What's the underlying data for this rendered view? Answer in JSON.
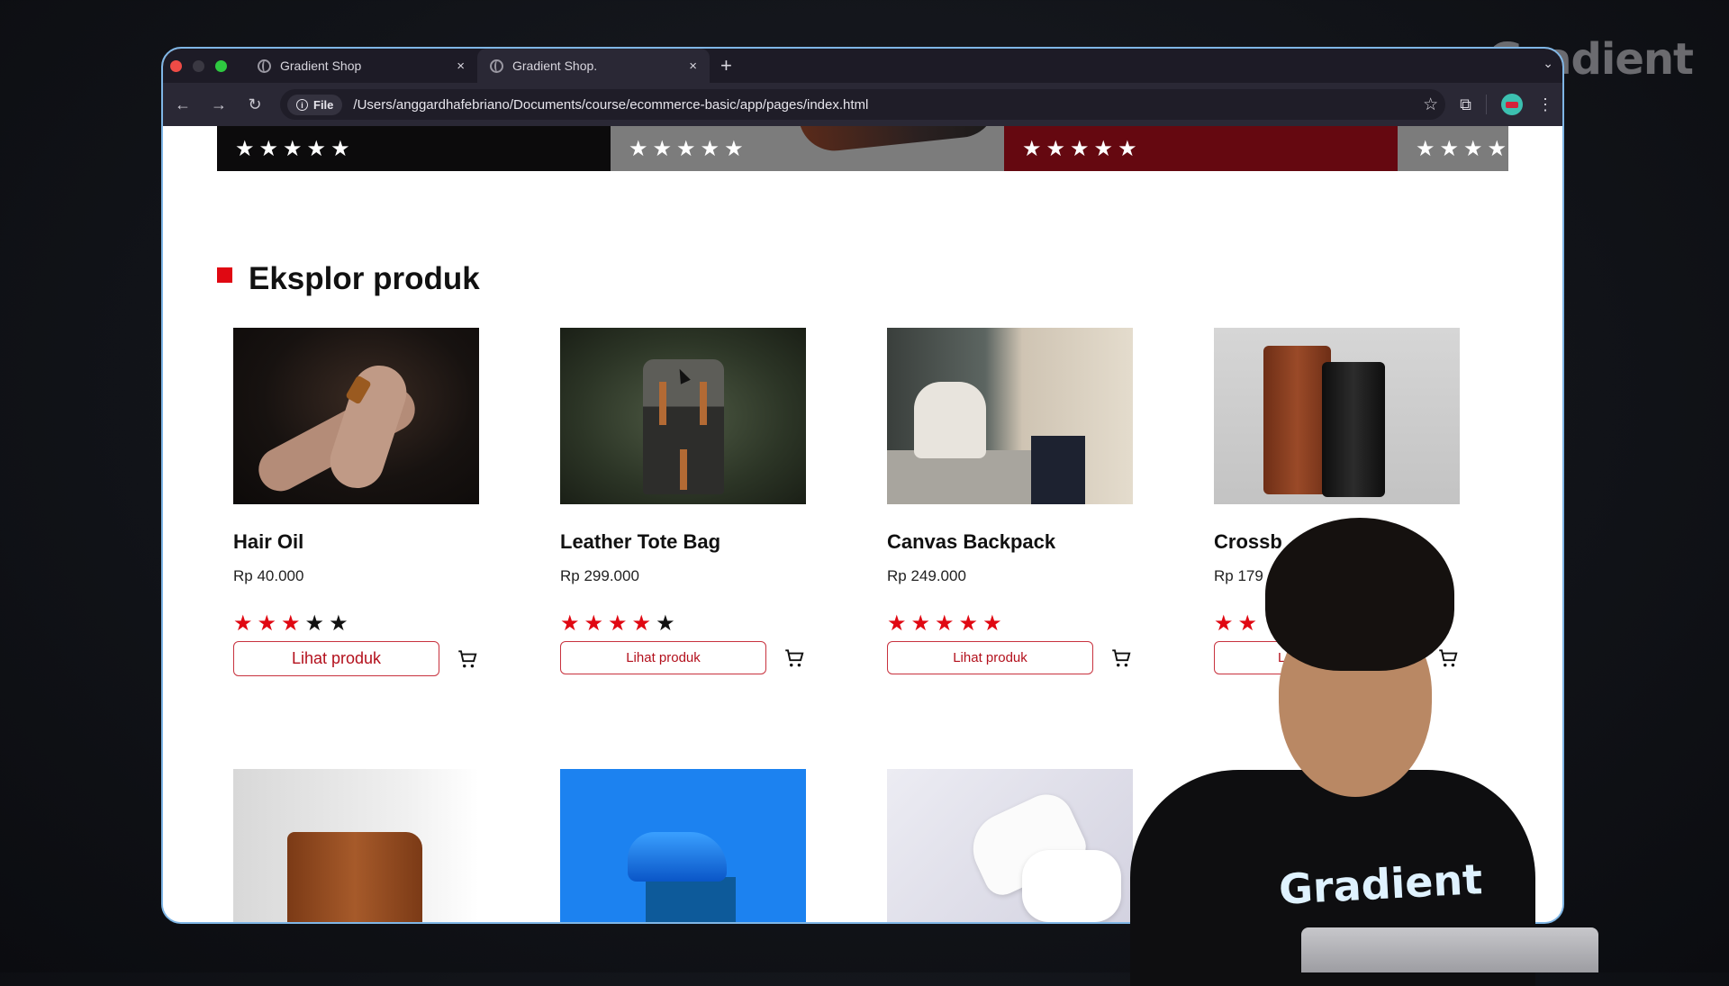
{
  "watermark": "Gradient",
  "browser": {
    "tabs": [
      {
        "title": "Gradient Shop",
        "active": false
      },
      {
        "title": "Gradient Shop.",
        "active": true
      }
    ],
    "new_tab_label": "+",
    "close_label": "×",
    "tab_menu_label": "⌄",
    "nav": {
      "back": "←",
      "forward": "→",
      "reload": "↻"
    },
    "site_chip": {
      "icon": "i",
      "label": "File"
    },
    "url": "/Users/anggardhafebriano/Documents/course/ecommerce-basic/app/pages/index.html",
    "bookmark_icon": "☆",
    "extensions_icon": "⧉",
    "menu_icon": "⋮"
  },
  "banner": {
    "segments": [
      {
        "rating_label": "★★★★★",
        "color": "#0c0b0c"
      },
      {
        "rating_label": "★★★★★",
        "color": "#7c7c7c"
      },
      {
        "rating_label": "★★★★★",
        "color": "#650810"
      },
      {
        "rating_label": "★★★★",
        "color": "#7c7c7c"
      }
    ]
  },
  "section": {
    "title": "Eksplor produk",
    "accent_color": "#e00812"
  },
  "products": [
    {
      "name": "Hair Oil",
      "price": "Rp 40.000",
      "rating": 3,
      "max_rating": 5,
      "button": "Lihat produk"
    },
    {
      "name": "Leather Tote Bag",
      "price": "Rp 299.000",
      "rating": 4,
      "max_rating": 5,
      "button": "Lihat produk"
    },
    {
      "name": "Canvas Backpack",
      "price": "Rp 249.000",
      "rating": 5,
      "max_rating": 5,
      "button": "Lihat produk"
    },
    {
      "name": "Crossb",
      "price": "Rp 179",
      "rating_visible": 2,
      "button": "L"
    }
  ],
  "row2_products": [
    {
      "image": "leather-bag"
    },
    {
      "image": "blue-sneaker"
    },
    {
      "image": "white-sneaker"
    }
  ],
  "presenter": {
    "shirt_text": "Gradient"
  },
  "colors": {
    "accent": "#e00812",
    "button_border": "#c8323e",
    "button_text": "#b3101c",
    "star_off": "#111111"
  }
}
